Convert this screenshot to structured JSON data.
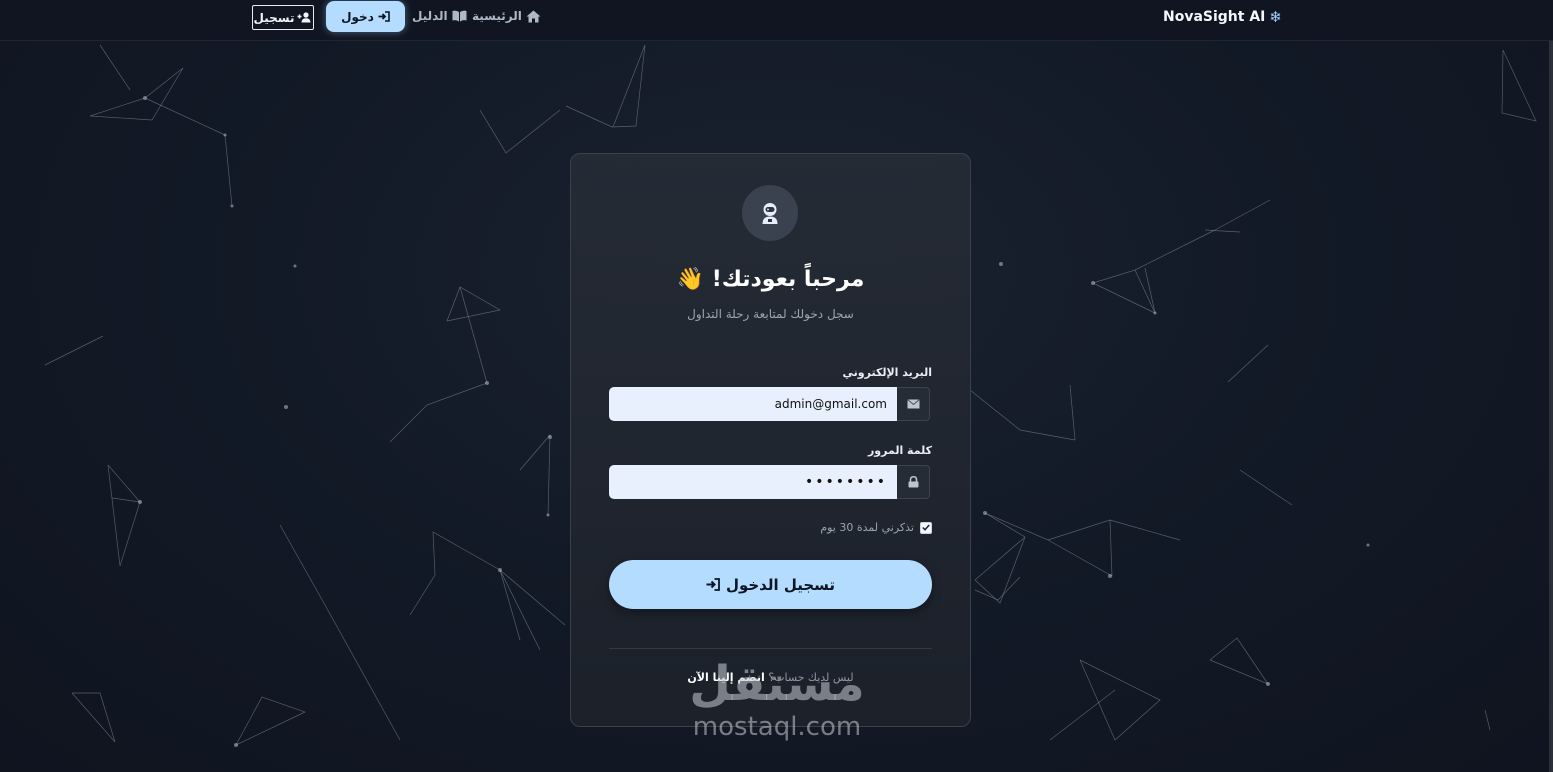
{
  "nav": {
    "brand": "NovaSight AI",
    "brand_icon": "snowflake-icon",
    "home_label": "الرئيسية",
    "guide_label": "الدليل",
    "login_label": "دخول",
    "register_label": "تسجيل"
  },
  "card": {
    "title": "مرحباً بعودتك!",
    "title_emoji": "👋",
    "subtitle": "سجل دخولك لمتابعة رحلة التداول",
    "email_label": "البريد الإلكتروني",
    "email_value": "admin@gmail.com",
    "password_label": "كلمة المرور",
    "password_value": "••••••••",
    "remember_label": "تذكرني لمدة 30 يوم",
    "remember_checked": true,
    "submit_label": "تسجيل الدخول",
    "no_account_text": "ليس لديك حساب؟",
    "join_link": "انضم إلينا الآن"
  },
  "watermark": {
    "arabic": "مستقل",
    "domain": "mostaql.com"
  },
  "colors": {
    "accent": "#b4dcff",
    "background": "#111723",
    "card": "#232934"
  }
}
